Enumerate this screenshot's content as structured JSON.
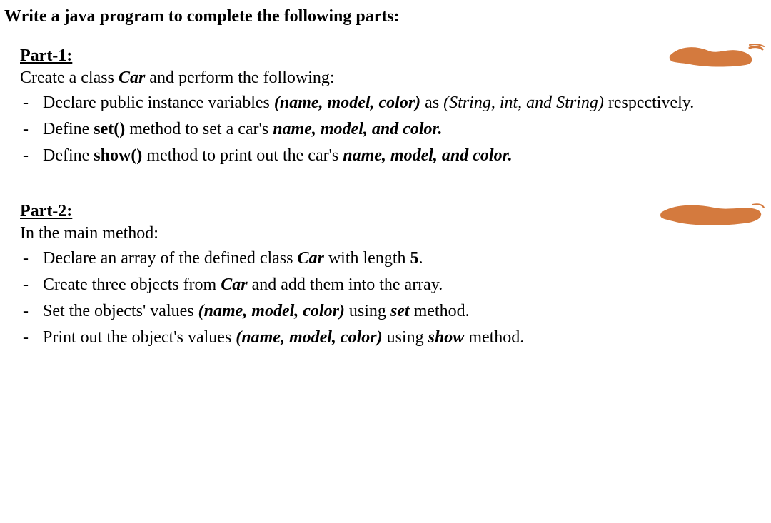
{
  "title": "Write a java program to complete the following parts:",
  "part1": {
    "header": "Part-1:",
    "intro_prefix": "Create a class ",
    "intro_class": "Car",
    "intro_suffix": " and perform the following:",
    "b1_a": "Declare public instance variables ",
    "b1_vars": "(name, model, color)",
    "b1_mid": " as ",
    "b1_types": "(String, int, and String)",
    "b1_end": " respectively.",
    "b2_a": "Define ",
    "b2_m": "set()",
    "b2_b": " method to set a car's ",
    "b2_vars": "name, model, and color.",
    "b3_a": "Define ",
    "b3_m": "show()",
    "b3_b": " method to print out the car's ",
    "b3_vars": "name, model, and color."
  },
  "part2": {
    "header": "Part-2:",
    "intro": "In the main method:",
    "b1_a": "Declare an array of the defined class ",
    "b1_class": "Car",
    "b1_b": " with length ",
    "b1_len": "5",
    "b1_c": ".",
    "b2_a": "Create three objects from ",
    "b2_class": "Car",
    "b2_b": " and add them into the array.",
    "b3_a": "Set the objects' values ",
    "b3_vars": "(name, model, color)",
    "b3_b": " using ",
    "b3_m": "set",
    "b3_c": " method.",
    "b4_a": "Print out the object's values ",
    "b4_vars": "(name, model, color)",
    "b4_b": "  using ",
    "b4_m": "show",
    "b4_c": " method."
  }
}
